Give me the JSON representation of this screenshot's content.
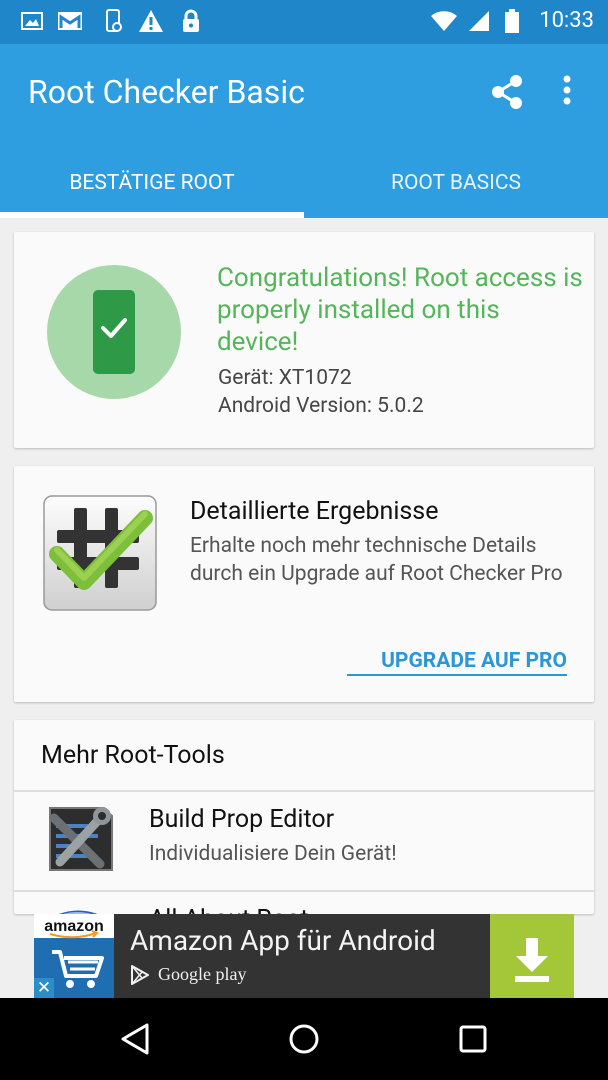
{
  "status_bar": {
    "time": "10:33",
    "left_icons": [
      "image-notification-icon",
      "gmail-icon",
      "device-icon",
      "warning-icon",
      "lock-icon"
    ],
    "right_icons": [
      "wifi-icon",
      "signal-icon",
      "battery-icon"
    ]
  },
  "app_bar": {
    "title": "Root Checker Basic",
    "actions": [
      "share-icon",
      "overflow-menu-icon"
    ]
  },
  "tabs": [
    {
      "label": "BESTÄTIGE ROOT",
      "selected": true
    },
    {
      "label": "ROOT BASICS",
      "selected": false
    }
  ],
  "root_status": {
    "message": "Congratulations! Root access is properly installed on this device!",
    "device": "Gerät: XT1072",
    "android_version": "Android Version: 5.0.2",
    "status_color": "#54b55a",
    "icon": "phone-check-icon"
  },
  "pro_card": {
    "title": "Detaillierte Ergebnisse",
    "description": "Erhalte noch mehr technische Details durch ein Upgrade auf Root Checker Pro",
    "upgrade_label": "UPGRADE AUF PRO",
    "icon": "root-checker-pro-icon"
  },
  "tools": {
    "title": "Mehr Root-Tools",
    "items": [
      {
        "title": "Build Prop Editor",
        "subtitle": "Individualisiere Dein Gerät!",
        "icon": "build-prop-editor-icon"
      },
      {
        "title": "All About Root",
        "subtitle": "",
        "icon": "all-about-root-icon"
      }
    ]
  },
  "ad": {
    "logo_text": "amazon",
    "title": "Amazon App für Android",
    "store_label": "Google play",
    "close_label": "✕",
    "action_icon": "download-icon"
  },
  "colors": {
    "status_bar": "#1e86c9",
    "app_bar": "#2f9ee0",
    "accent_link": "#2c96d6",
    "success_green": "#54b55a",
    "ad_background": "#333333",
    "download_green": "#a4c639"
  },
  "navigation": [
    "back-icon",
    "home-icon",
    "recent-apps-icon"
  ]
}
